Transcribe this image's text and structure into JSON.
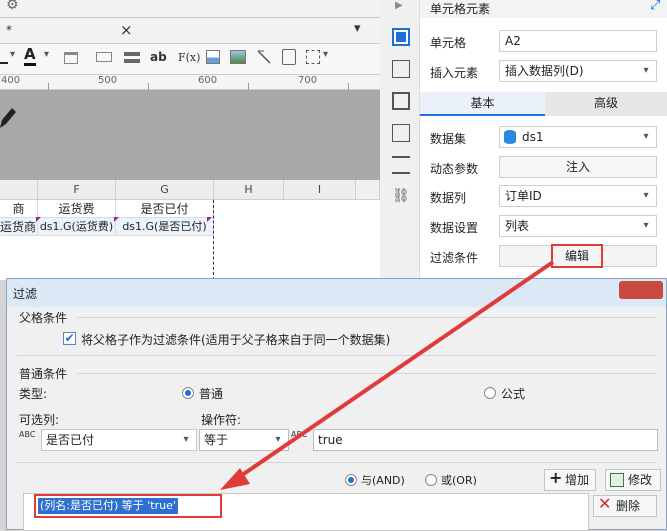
{
  "designer": {
    "tab_label": "*",
    "tab_close": "×",
    "toolbar": {
      "font_color_label": "A",
      "ab_label": "ab",
      "fx_label": "F(x)"
    },
    "ruler": [
      "400",
      "500",
      "600",
      "700"
    ],
    "columns": [
      "F",
      "G",
      "H",
      "I"
    ],
    "header_row": [
      "商",
      "运货费",
      "是否已付"
    ],
    "data_row": [
      "运货商)",
      "ds1.G(运货费)",
      "ds1.G(是否已付)"
    ]
  },
  "panel": {
    "title": "单元格元素",
    "cell_label": "单元格",
    "cell_value": "A2",
    "insert_label": "插入元素",
    "insert_value": "插入数据列(D)",
    "tab_basic": "基本",
    "tab_advanced": "高级",
    "dataset_label": "数据集",
    "dataset_value": "ds1",
    "dynamic_label": "动态参数",
    "inject_button": "注入",
    "column_label": "数据列",
    "column_value": "订单ID",
    "setting_label": "数据设置",
    "setting_value": "列表",
    "filter_label": "过滤条件",
    "edit_button": "编辑"
  },
  "dialog": {
    "title": "过滤",
    "parent_section": "父格条件",
    "parent_checkbox": "将父格子作为过滤条件(适用于父子格来自于同一个数据集)",
    "normal_section": "普通条件",
    "type_label": "类型:",
    "type_normal": "普通",
    "type_formula": "公式",
    "optional_col_label": "可选列:",
    "operator_label": "操作符:",
    "column_value": "是否已付",
    "operator_value": "等于",
    "value_text": "true",
    "and_label": "与(AND)",
    "or_label": "或(OR)",
    "add_button": "增加",
    "modify_button": "修改",
    "delete_button": "删除",
    "condition_item": "(列名:是否已付) 等于 'true'"
  },
  "colors": {
    "accent": "#1e6fd6",
    "annotation": "#e03b3b",
    "selection": "#2f6fcf"
  }
}
